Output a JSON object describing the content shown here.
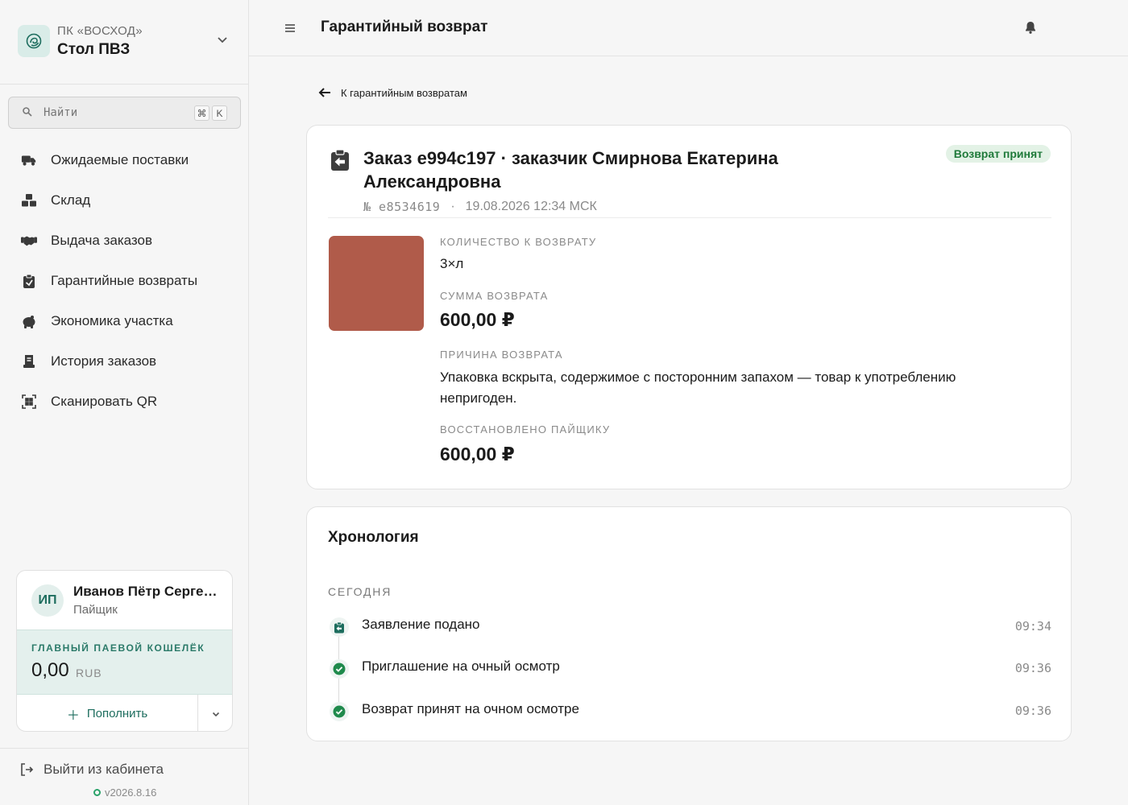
{
  "sidebar": {
    "org": {
      "kind": "ПК «ВОСХОД»",
      "name": "Стол ПВЗ"
    },
    "search": {
      "placeholder": "Найти",
      "kbd1": "⌘",
      "kbd2": "K"
    },
    "nav": [
      {
        "label": "Ожидаемые поставки",
        "icon": "truck-icon"
      },
      {
        "label": "Склад",
        "icon": "boxes-icon"
      },
      {
        "label": "Выдача заказов",
        "icon": "handshake-icon"
      },
      {
        "label": "Гарантийные возвраты",
        "icon": "clipboard-return-icon"
      },
      {
        "label": "Экономика участка",
        "icon": "piggy-bank-icon"
      },
      {
        "label": "История заказов",
        "icon": "receipt-icon"
      },
      {
        "label": "Сканировать QR",
        "icon": "qr-icon"
      }
    ],
    "user": {
      "initials": "ИП",
      "name": "Иванов Пётр Сергеевич",
      "role": "Пайщик",
      "wallet_label": "ГЛАВНЫЙ ПАЕВОЙ КОШЕЛЁК",
      "wallet_amount": "0,00",
      "wallet_currency": "RUB",
      "topup_label": "Пополнить"
    },
    "logout_label": "Выйти из кабинета",
    "version": "v2026.8.16"
  },
  "header": {
    "title": "Гарантийный возврат"
  },
  "back_label": "К гарантийным возвратам",
  "order": {
    "title": "Заказ e994c197 · заказчик Смирнова Екатерина Александровна",
    "number": "№ e8534619",
    "separator": "·",
    "datetime": "19.08.2026 12:34 МСК",
    "status": "Возврат принят",
    "thumb_color": "#b05b4a",
    "fields": {
      "qty_label": "КОЛИЧЕСТВО К ВОЗВРАТУ",
      "qty_value": "3×л",
      "sum_label": "СУММА ВОЗВРАТА",
      "sum_value": "600,00 ₽",
      "reason_label": "ПРИЧИНА ВОЗВРАТА",
      "reason_value": "Упаковка вскрыта, содержимое с посторонним запахом — товар к употреблению непригоден.",
      "restored_label": "ВОССТАНОВЛЕНО ПАЙЩИКУ",
      "restored_value": "600,00 ₽"
    }
  },
  "chronology": {
    "title": "Хронология",
    "day": "СЕГОДНЯ",
    "events": [
      {
        "label": "Заявление подано",
        "time": "09:34",
        "icon": "clipboard-return-icon"
      },
      {
        "label": "Приглашение на очный осмотр",
        "time": "09:36",
        "icon": "check-circle-icon"
      },
      {
        "label": "Возврат принят на очном осмотре",
        "time": "09:36",
        "icon": "check-circle-icon"
      }
    ]
  },
  "colors": {
    "accent": "#1d6d5e",
    "status_green": "#1f7a3a"
  }
}
